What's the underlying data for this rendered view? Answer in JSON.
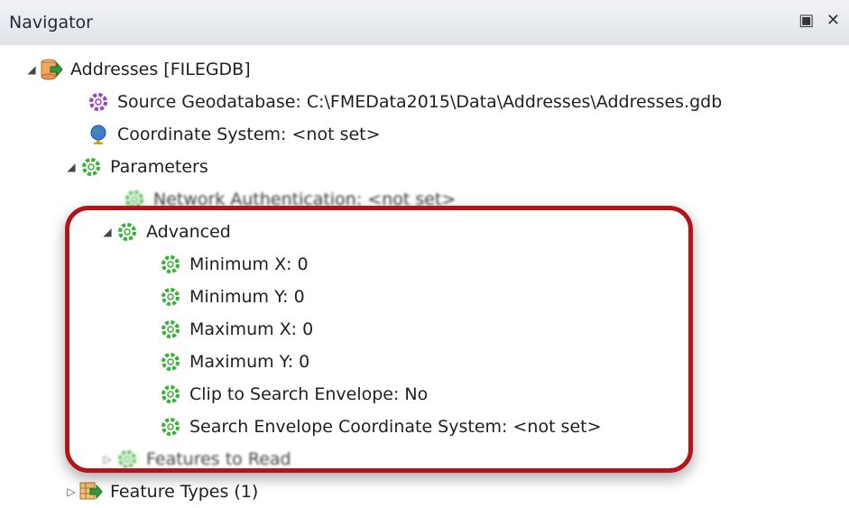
{
  "window": {
    "title": "Navigator",
    "controls": "▣ ✕"
  },
  "tree": {
    "addresses": "Addresses [FILEGDB]",
    "source_gdb": "Source Geodatabase: C:\\FMEData2015\\Data\\Addresses\\Addresses.gdb",
    "coordinate_system": "Coordinate System: <not set>",
    "parameters": "Parameters",
    "network_auth": "Network Authentication: <not set>",
    "advanced": "Advanced",
    "min_x": "Minimum X: 0",
    "min_y": "Minimum Y: 0",
    "max_x": "Maximum X: 0",
    "max_y": "Maximum Y: 0",
    "clip": "Clip to Search Envelope: No",
    "search_cs": "Search Envelope Coordinate System: <not set>",
    "features_to_read": "Features to Read",
    "feature_types": "Feature Types (1)"
  },
  "colors": {
    "highlight": "#b3141a",
    "gear_green": "#33b233",
    "gear_purple": "#9b3fbf"
  }
}
